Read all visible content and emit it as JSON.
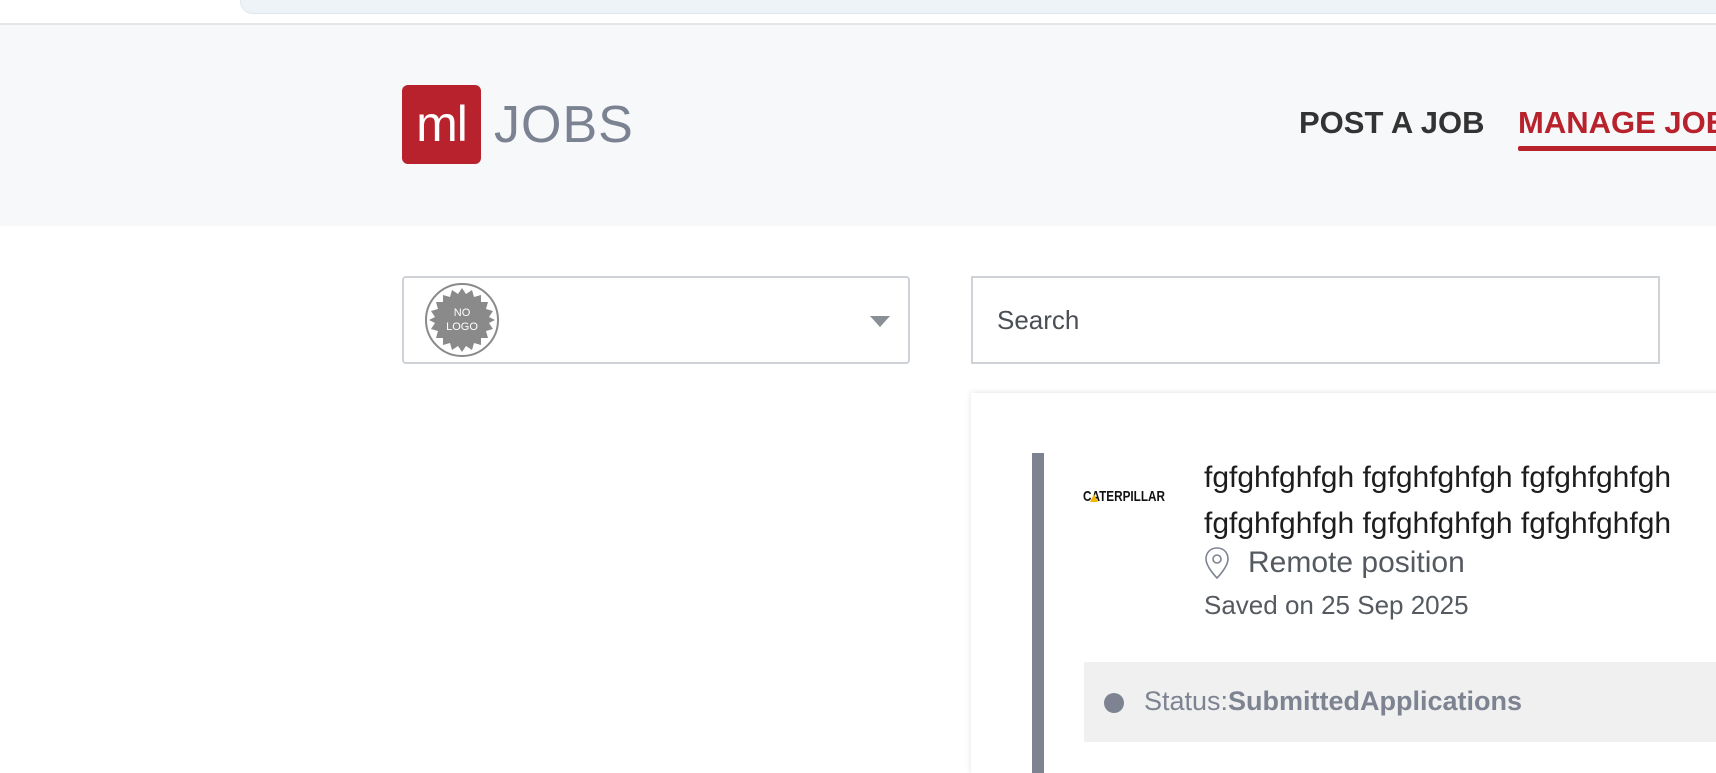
{
  "header": {
    "logo_mark": "ml",
    "logo_text": "JOBS",
    "nav": {
      "post_job": "POST A JOB",
      "manage_jobs": "MANAGE JOBS"
    }
  },
  "filters": {
    "company_select": {
      "logo_line1": "NO",
      "logo_line2": "LOGO"
    },
    "search": {
      "placeholder": "Search"
    }
  },
  "job_card": {
    "company_logo_text": "CATERPILLAR",
    "title_line1": "fgfghfghfgh fgfghfghfgh fgfghfghfgh",
    "title_line2": "fgfghfghfgh fgfghfghfgh fgfghfghfgh",
    "location": "Remote position",
    "saved_text": "Saved on 25 Sep 2025",
    "status_label": "Status:",
    "status_value": "SubmittedApplications"
  },
  "colors": {
    "brand": "#b8222c",
    "status": "#7d8391"
  }
}
